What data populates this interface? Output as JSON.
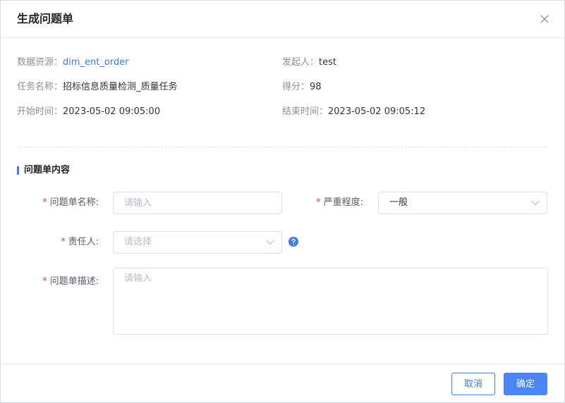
{
  "dialog": {
    "title": "生成问题单",
    "close_icon": "close-icon"
  },
  "info": {
    "datasource_label": "数据资源：",
    "datasource_value": "dim_ent_order",
    "initiator_label": "发起人：",
    "initiator_value": "test",
    "task_label": "任务名称：",
    "task_value": "招标信息质量检测_质量任务",
    "score_label": "得分：",
    "score_value": "98",
    "start_label": "开始时间：",
    "start_value": "2023-05-02 09:05:00",
    "end_label": "结束时间：",
    "end_value": "2023-05-02 09:05:12"
  },
  "section": {
    "title": "问题单内容"
  },
  "form": {
    "required_mark": "*",
    "name_label": "问题单名称:",
    "name_placeholder": "请输入",
    "severity_label": "严重程度:",
    "severity_value": "一般",
    "owner_label": "责任人:",
    "owner_placeholder": "请选择",
    "desc_label": "问题单描述:",
    "desc_placeholder": "请输入",
    "help_icon": "question-circle-icon",
    "chevron_icon": "chevron-down-icon"
  },
  "footer": {
    "cancel_label": "取消",
    "ok_label": "确定"
  },
  "colors": {
    "accent": "#3e7bf0",
    "primary_button": "#4a86f7",
    "required": "#e84a3c"
  }
}
